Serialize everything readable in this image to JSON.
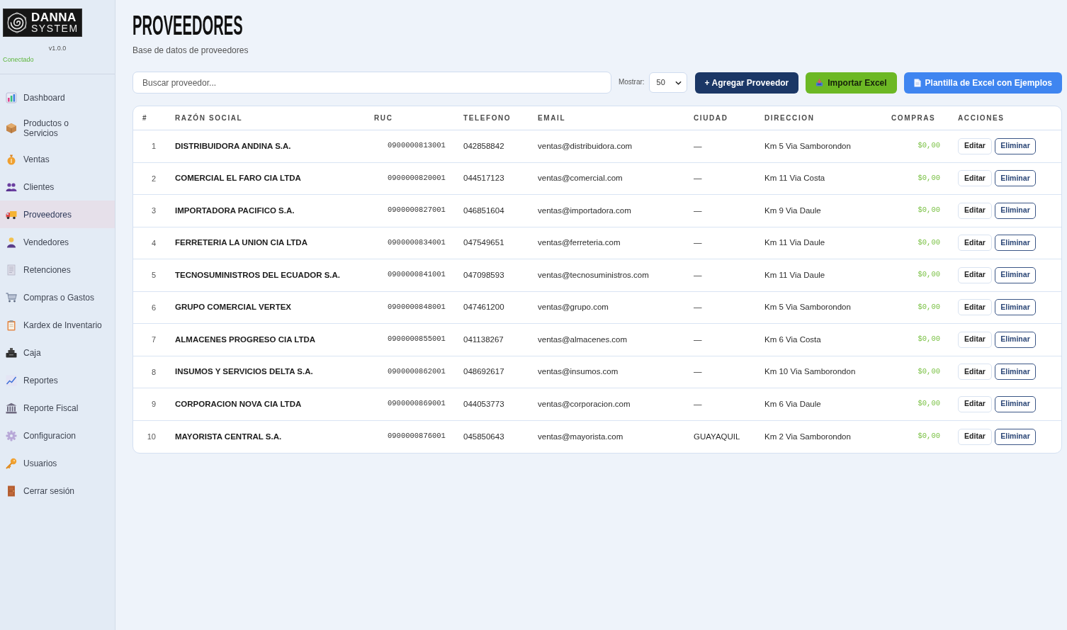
{
  "sidebar": {
    "logo": {
      "line_1": "DANNA",
      "line_2": "SYSTEM"
    },
    "version": "v1.0.0",
    "status": "Conectado",
    "items": [
      {
        "label": "Dashboard",
        "selected": false
      },
      {
        "label": "Productos o Servicios",
        "selected": false
      },
      {
        "label": "Ventas",
        "selected": false
      },
      {
        "label": "Clientes",
        "selected": false
      },
      {
        "label": "Proveedores",
        "selected": true
      },
      {
        "label": "Vendedores",
        "selected": false
      },
      {
        "label": "Retenciones",
        "selected": false
      },
      {
        "label": "Compras o Gastos",
        "selected": false
      },
      {
        "label": "Kardex de Inventario",
        "selected": false
      },
      {
        "label": "Caja",
        "selected": false
      },
      {
        "label": "Reportes",
        "selected": false
      },
      {
        "label": "Reporte Fiscal",
        "selected": false
      },
      {
        "label": "Configuracion",
        "selected": false
      },
      {
        "label": "Usuarios",
        "selected": false
      },
      {
        "label": "Cerrar sesión",
        "selected": false
      }
    ]
  },
  "header": {
    "title": "PROVEEDORES",
    "subtitle": "Base de datos de proveedores"
  },
  "toolbar": {
    "search": {
      "placeholder": "Buscar proveedor..."
    },
    "page_size": {
      "label": "Mostrar:",
      "value": "50"
    },
    "buttons": [
      {
        "label": "+ Agregar Proveedor",
        "kind": "add"
      },
      {
        "label": "Importar Excel",
        "kind": "import"
      },
      {
        "label": "Plantilla de Excel con Ejemplos",
        "kind": "template"
      }
    ]
  },
  "table": {
    "columns": [
      "#",
      "RAZÓN SOCIAL",
      "RUC",
      "TELEFONO",
      "EMAIL",
      "CIUDAD",
      "DIRECCION",
      "COMPRAS",
      "ACCIONES"
    ],
    "rows": [
      {
        "number": "1",
        "razon_social": "DISTRIBUIDORA ANDINA S.A.",
        "ruc": "0900000813001",
        "telefono": "042858842",
        "email": "ventas@distribuidora.com",
        "ciudad": "—",
        "direccion": "Km 5 Via Samborondon",
        "compras": "$0,00",
        "actions": [
          {
            "label": "Editar",
            "kind": "edit"
          },
          {
            "label": "Eliminar",
            "kind": "delete"
          }
        ]
      },
      {
        "number": "2",
        "razon_social": "COMERCIAL EL FARO CIA LTDA",
        "ruc": "0900000820001",
        "telefono": "044517123",
        "email": "ventas@comercial.com",
        "ciudad": "—",
        "direccion": "Km 11 Via Costa",
        "compras": "$0,00",
        "actions": [
          {
            "label": "Editar",
            "kind": "edit"
          },
          {
            "label": "Eliminar",
            "kind": "delete"
          }
        ]
      },
      {
        "number": "3",
        "razon_social": "IMPORTADORA PACIFICO S.A.",
        "ruc": "0900000827001",
        "telefono": "046851604",
        "email": "ventas@importadora.com",
        "ciudad": "—",
        "direccion": "Km 9 Via Daule",
        "compras": "$0,00",
        "actions": [
          {
            "label": "Editar",
            "kind": "edit"
          },
          {
            "label": "Eliminar",
            "kind": "delete"
          }
        ]
      },
      {
        "number": "4",
        "razon_social": "FERRETERIA LA UNION CIA LTDA",
        "ruc": "0900000834001",
        "telefono": "047549651",
        "email": "ventas@ferreteria.com",
        "ciudad": "—",
        "direccion": "Km 11 Via Daule",
        "compras": "$0,00",
        "actions": [
          {
            "label": "Editar",
            "kind": "edit"
          },
          {
            "label": "Eliminar",
            "kind": "delete"
          }
        ]
      },
      {
        "number": "5",
        "razon_social": "TECNOSUMINISTROS DEL ECUADOR S.A.",
        "ruc": "0900000841001",
        "telefono": "047098593",
        "email": "ventas@tecnosuministros.com",
        "ciudad": "—",
        "direccion": "Km 11 Via Daule",
        "compras": "$0,00",
        "actions": [
          {
            "label": "Editar",
            "kind": "edit"
          },
          {
            "label": "Eliminar",
            "kind": "delete"
          }
        ]
      },
      {
        "number": "6",
        "razon_social": "GRUPO COMERCIAL VERTEX",
        "ruc": "0900000848001",
        "telefono": "047461200",
        "email": "ventas@grupo.com",
        "ciudad": "—",
        "direccion": "Km 5 Via Samborondon",
        "compras": "$0,00",
        "actions": [
          {
            "label": "Editar",
            "kind": "edit"
          },
          {
            "label": "Eliminar",
            "kind": "delete"
          }
        ]
      },
      {
        "number": "7",
        "razon_social": "ALMACENES PROGRESO CIA LTDA",
        "ruc": "0900000855001",
        "telefono": "041138267",
        "email": "ventas@almacenes.com",
        "ciudad": "—",
        "direccion": "Km 6 Via Costa",
        "compras": "$0,00",
        "actions": [
          {
            "label": "Editar",
            "kind": "edit"
          },
          {
            "label": "Eliminar",
            "kind": "delete"
          }
        ]
      },
      {
        "number": "8",
        "razon_social": "INSUMOS Y SERVICIOS DELTA S.A.",
        "ruc": "0900000862001",
        "telefono": "048692617",
        "email": "ventas@insumos.com",
        "ciudad": "—",
        "direccion": "Km 10 Via Samborondon",
        "compras": "$0,00",
        "actions": [
          {
            "label": "Editar",
            "kind": "edit"
          },
          {
            "label": "Eliminar",
            "kind": "delete"
          }
        ]
      },
      {
        "number": "9",
        "razon_social": "CORPORACION NOVA CIA LTDA",
        "ruc": "0900000869001",
        "telefono": "044053773",
        "email": "ventas@corporacion.com",
        "ciudad": "—",
        "direccion": "Km 6 Via Daule",
        "compras": "$0,00",
        "actions": [
          {
            "label": "Editar",
            "kind": "edit"
          },
          {
            "label": "Eliminar",
            "kind": "delete"
          }
        ]
      },
      {
        "number": "10",
        "razon_social": "MAYORISTA CENTRAL S.A.",
        "ruc": "0900000876001",
        "telefono": "045850643",
        "email": "ventas@mayorista.com",
        "ciudad": "GUAYAQUIL",
        "direccion": "Km 2 Via Samborondon",
        "compras": "$0,00",
        "actions": [
          {
            "label": "Editar",
            "kind": "edit"
          },
          {
            "label": "Eliminar",
            "kind": "delete"
          }
        ]
      }
    ]
  }
}
